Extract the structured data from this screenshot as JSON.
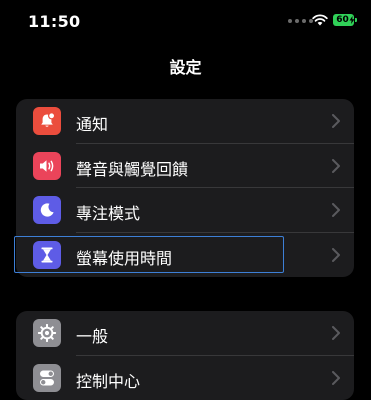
{
  "status": {
    "time": "11:50",
    "battery": "60"
  },
  "nav": {
    "title": "設定"
  },
  "group1": [
    {
      "label": "通知",
      "icon": "bell-badge-icon",
      "color": "#eb4d3d"
    },
    {
      "label": "聲音與觸覺回饋",
      "icon": "speaker-icon",
      "color": "#eb445a"
    },
    {
      "label": "專注模式",
      "icon": "moon-icon",
      "color": "#5e5ce6"
    },
    {
      "label": "螢幕使用時間",
      "icon": "hourglass-icon",
      "color": "#5e5ce6"
    }
  ],
  "group2": [
    {
      "label": "一般",
      "icon": "gear-icon",
      "color": "#8e8e93"
    },
    {
      "label": "控制中心",
      "icon": "toggles-icon",
      "color": "#8e8e93"
    }
  ],
  "colors": {
    "focus_ring": "#3d7fd6",
    "battery_fill": "#30d158"
  }
}
